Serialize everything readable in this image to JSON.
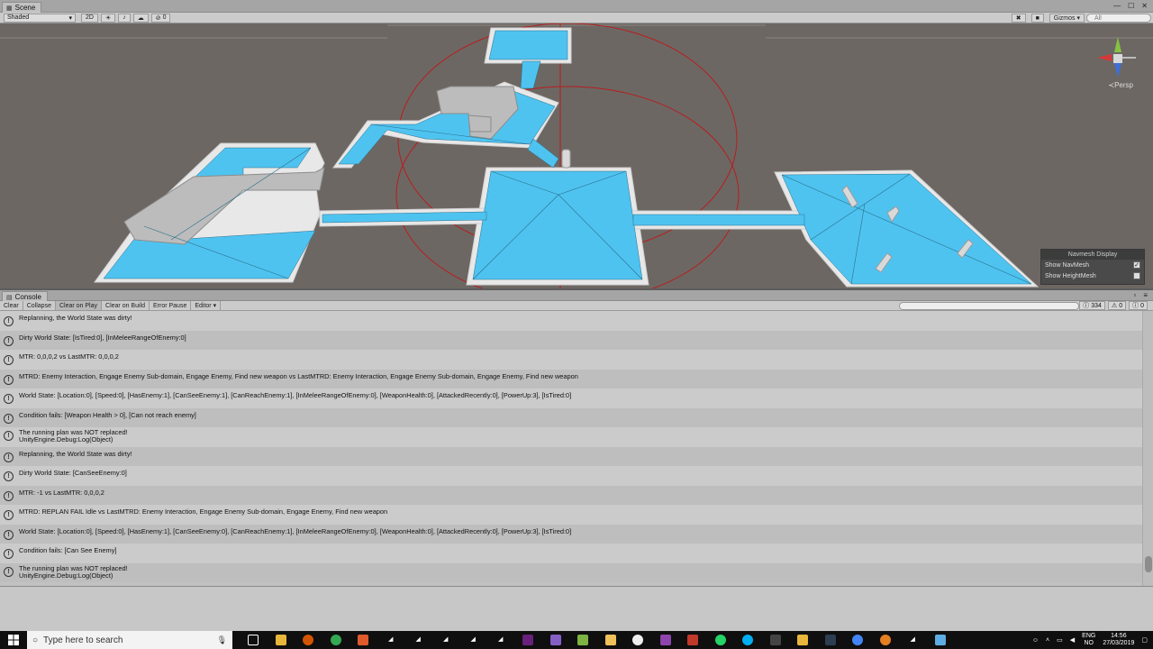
{
  "scene": {
    "tab_label": "Scene",
    "shading_mode": "Shaded",
    "toggle_2d": "2D",
    "toggle_lighting": "☀",
    "toggle_audio": "♪",
    "toggle_effects": "☁",
    "hidden_count": "0",
    "gizmos_label": "Gizmos",
    "search_placeholder": "All",
    "persp_label": "Persp",
    "navmesh_display": {
      "title": "Navmesh Display",
      "show_navmesh_label": "Show NavMesh",
      "show_navmesh_checked": true,
      "show_heightmesh_label": "Show HeightMesh",
      "show_heightmesh_checked": false
    },
    "colors": {
      "navmesh": "#4fc3f0",
      "ground": "#6d6763",
      "walls": "#e6e6e6"
    }
  },
  "console": {
    "tab_label": "Console",
    "toolbar": {
      "clear": "Clear",
      "collapse": "Collapse",
      "clear_on_play": "Clear on Play",
      "clear_on_build": "Clear on Build",
      "error_pause": "Error Pause",
      "editor": "Editor"
    },
    "counts": {
      "info": "334",
      "warning": "0",
      "error": "0"
    },
    "logs": [
      {
        "text": "Replanning, the World State was dirty!"
      },
      {
        "text": "Dirty World State: [IsTired:0], [InMeleeRangeOfEnemy:0]"
      },
      {
        "text": "MTR: 0,0,0,2 vs LastMTR: 0,0,0,2"
      },
      {
        "text": "MTRD: Enemy Interaction, Engage Enemy Sub-domain, Engage Enemy, Find new weapon vs LastMTRD: Enemy Interaction, Engage Enemy Sub-domain, Engage Enemy, Find new weapon"
      },
      {
        "text": "World State: [Location:0], [Speed:0], [HasEnemy:1], [CanSeeEnemy:1], [CanReachEnemy:1], [InMeleeRangeOfEnemy:0], [WeaponHealth:0], [AttackedRecently:0], [PowerUp:3], [IsTired:0]"
      },
      {
        "text": "Condition fails: [Weapon Health > 0], [Can not reach enemy]"
      },
      {
        "text": "The running plan was NOT replaced!\nUnityEngine.Debug:Log(Object)"
      },
      {
        "text": "Replanning, the World State was dirty!"
      },
      {
        "text": "Dirty World State: [CanSeeEnemy:0]"
      },
      {
        "text": "MTR: -1 vs LastMTR: 0,0,0,2"
      },
      {
        "text": "MTRD: REPLAN FAIL Idle vs LastMTRD: Enemy Interaction, Engage Enemy Sub-domain, Engage Enemy, Find new weapon"
      },
      {
        "text": "World State: [Location:0], [Speed:0], [HasEnemy:1], [CanSeeEnemy:0], [CanReachEnemy:1], [InMeleeRangeOfEnemy:0], [WeaponHealth:0], [AttackedRecently:0], [PowerUp:3], [IsTired:0]"
      },
      {
        "text": "Condition fails: [Can See Enemy]"
      },
      {
        "text": "The running plan was NOT replaced!\nUnityEngine.Debug:Log(Object)"
      }
    ]
  },
  "taskbar": {
    "search_placeholder": "Type here to search",
    "language_line1": "ENG",
    "language_line2": "NO",
    "time": "14:56",
    "date": "27/03/2019"
  }
}
